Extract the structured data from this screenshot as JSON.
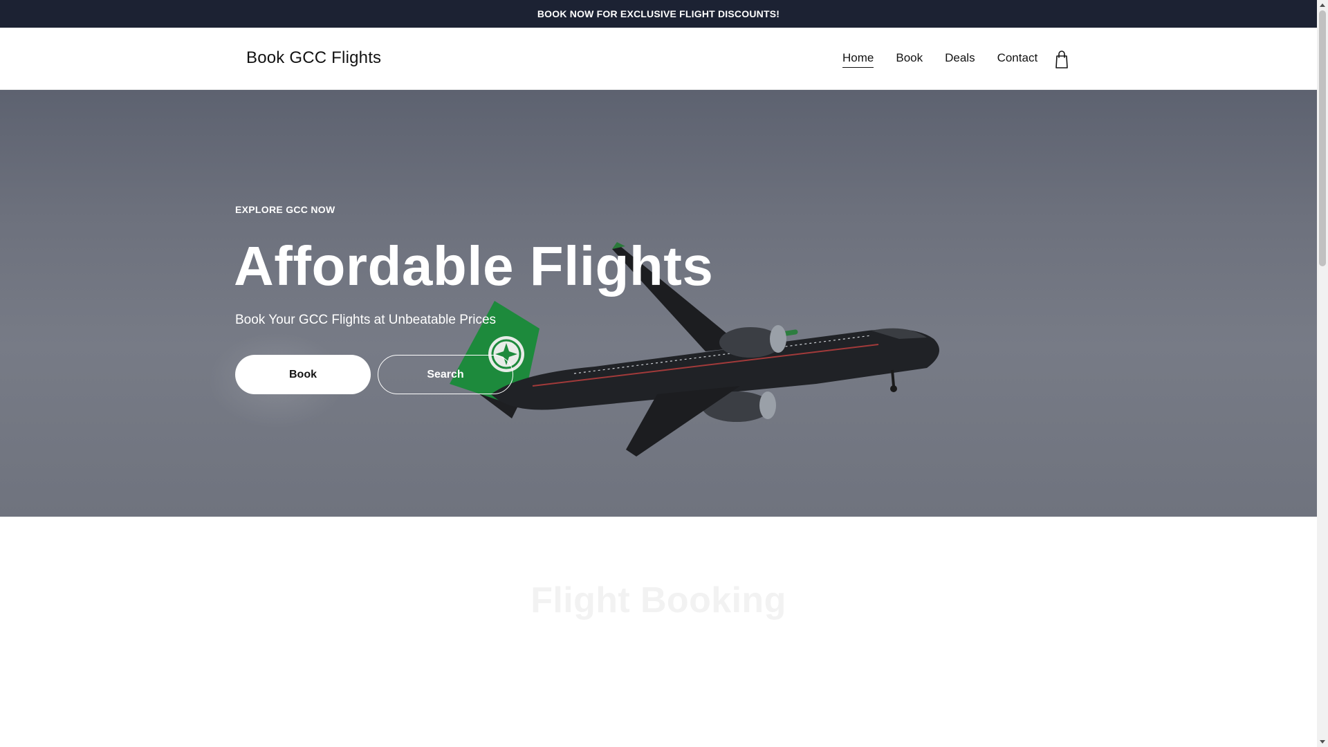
{
  "announcement": {
    "text": "BOOK NOW FOR EXCLUSIVE FLIGHT DISCOUNTS!"
  },
  "header": {
    "brand": "Book GCC Flights",
    "nav": [
      {
        "label": "Home",
        "active": true
      },
      {
        "label": "Book",
        "active": false
      },
      {
        "label": "Deals",
        "active": false
      },
      {
        "label": "Contact",
        "active": false
      }
    ],
    "cart_icon": "shopping-bag-icon"
  },
  "hero": {
    "eyebrow": "EXPLORE GCC NOW",
    "title": "Affordable Flights",
    "subtitle": "Book Your GCC Flights at Unbeatable Prices",
    "primary_button": "Book",
    "secondary_button": "Search",
    "image": "airplane-in-flight"
  },
  "section": {
    "eyebrow": "",
    "title": "Flight Booking"
  },
  "colors": {
    "announcement_bg": "#1c2233",
    "hero_overlay": "#6d717d",
    "text_dark": "#121212",
    "plane_green": "#1f8a3e"
  }
}
